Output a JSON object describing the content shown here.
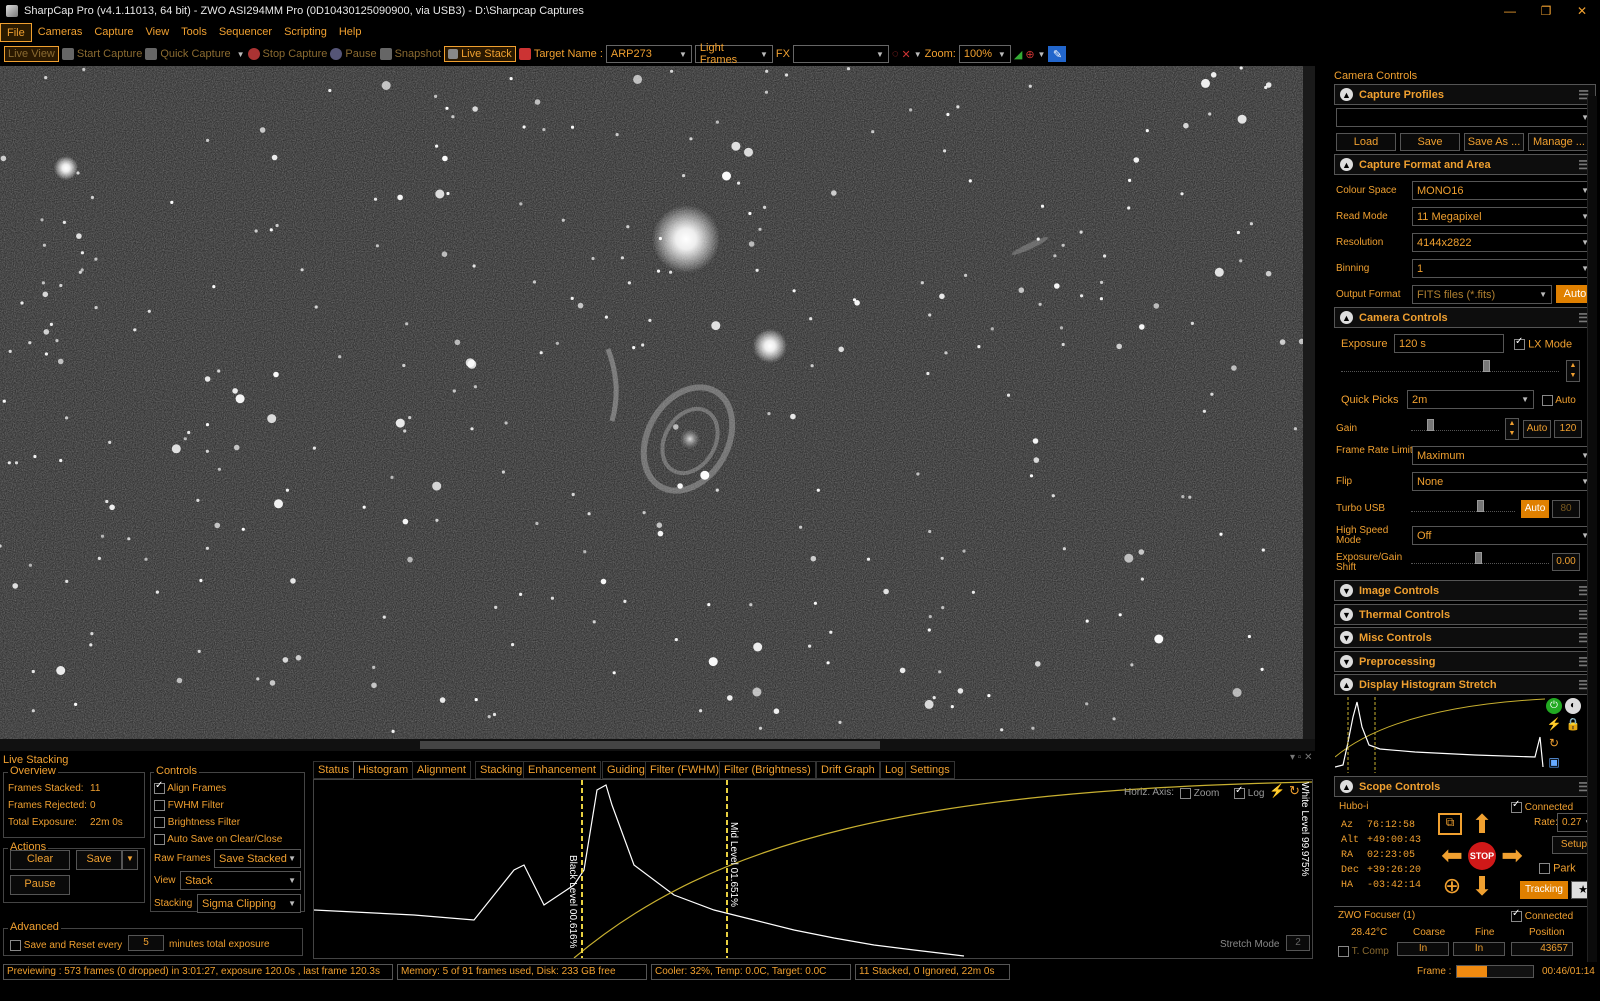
{
  "window": {
    "title": "SharpCap Pro (v4.1.11013, 64 bit) - ZWO ASI294MM Pro (0D10430125090900, via USB3) - D:\\Sharpcap Captures"
  },
  "menu": [
    "File",
    "Cameras",
    "Capture",
    "View",
    "Tools",
    "Sequencer",
    "Scripting",
    "Help"
  ],
  "toolbar": {
    "live_view": "Live View",
    "start_capture": "Start Capture",
    "quick_capture": "Quick Capture",
    "stop_capture": "Stop Capture",
    "pause": "Pause",
    "snapshot": "Snapshot",
    "live_stack": "Live Stack",
    "target_label": "Target Name :",
    "target_value": "ARP273",
    "frame_type": "Light Frames",
    "fx_label": "FX",
    "fx_value": "",
    "zoom_label": "Zoom:",
    "zoom_value": "100%"
  },
  "right_panel": {
    "title": "Camera Controls",
    "capture_profiles": {
      "header": "Capture Profiles",
      "profile_value": "",
      "buttons": [
        "Load",
        "Save",
        "Save As ...",
        "Manage ..."
      ]
    },
    "capture_format": {
      "header": "Capture Format and Area",
      "rows": [
        {
          "label": "Colour Space",
          "value": "MONO16"
        },
        {
          "label": "Read Mode",
          "value": "11 Megapixel"
        },
        {
          "label": "Resolution",
          "value": "4144x2822"
        },
        {
          "label": "Binning",
          "value": "1"
        },
        {
          "label": "Output Format",
          "value": "FITS files (*.fits)"
        }
      ],
      "auto": "Auto"
    },
    "camera_controls": {
      "header": "Camera Controls",
      "exposure_label": "Exposure",
      "exposure_value": "120 s",
      "lx_mode": "LX Mode",
      "quick_picks_label": "Quick Picks",
      "quick_picks_value": "2m",
      "auto": "Auto",
      "gain_label": "Gain",
      "gain_auto": "Auto",
      "gain_value": "120",
      "frame_rate_label": "Frame Rate Limit",
      "frame_rate_value": "Maximum",
      "flip_label": "Flip",
      "flip_value": "None",
      "turbo_label": "Turbo USB",
      "turbo_auto": "Auto",
      "turbo_value": "80",
      "high_speed_label": "High Speed Mode",
      "high_speed_value": "Off",
      "shift_label": "Exposure/Gain Shift",
      "shift_value": "0.00"
    },
    "collapsed": [
      "Image Controls",
      "Thermal Controls",
      "Misc Controls",
      "Preprocessing"
    ],
    "histogram_header": "Display Histogram Stretch",
    "scope": {
      "header": "Scope Controls",
      "name": "Hubo-i",
      "connected": "Connected",
      "coords": [
        {
          "k": "Az",
          "v": "76:12:58"
        },
        {
          "k": "Alt",
          "v": "+49:00:43"
        },
        {
          "k": "RA",
          "v": "02:23:05"
        },
        {
          "k": "Dec",
          "v": "+39:26:20"
        },
        {
          "k": "HA",
          "v": "-03:42:14"
        }
      ],
      "rate_label": "Rate:",
      "rate_value": "0.27",
      "setup": "Setup",
      "park": "Park",
      "stop": "STOP",
      "tracking": "Tracking"
    },
    "focuser": {
      "name": "ZWO Focuser (1)",
      "connected": "Connected",
      "temp": "28.42°C",
      "coarse": "Coarse",
      "fine": "Fine",
      "position_label": "Position",
      "t_comp": "T. Comp",
      "in": "In",
      "position_value": "43657"
    }
  },
  "live_stacking": {
    "title": "Live Stacking",
    "overview": {
      "title": "Overview",
      "frames_stacked_label": "Frames Stacked:",
      "frames_stacked": "11",
      "frames_rejected_label": "Frames Rejected:",
      "frames_rejected": "0",
      "total_exposure_label": "Total Exposure:",
      "total_exposure": "22m 0s"
    },
    "actions": {
      "title": "Actions",
      "clear": "Clear",
      "save": "Save",
      "pause": "Pause"
    },
    "advanced": {
      "title": "Advanced",
      "save_reset": "Save and Reset every",
      "minutes": "5",
      "minutes_suffix": "minutes total exposure"
    },
    "controls": {
      "title": "Controls",
      "checks": [
        {
          "label": "Align Frames",
          "on": true
        },
        {
          "label": "FWHM Filter",
          "on": false
        },
        {
          "label": "Brightness Filter",
          "on": false
        },
        {
          "label": "Auto Save on Clear/Close",
          "on": false
        }
      ],
      "raw_frames_label": "Raw Frames",
      "raw_frames_value": "Save Stacked",
      "view_label": "View",
      "view_value": "Stack",
      "stacking_label": "Stacking",
      "stacking_value": "Sigma Clipping"
    },
    "tabs": [
      "Status",
      "Histogram",
      "Alignment",
      "Stacking",
      "Enhancement",
      "Guiding",
      "Filter (FWHM)",
      "Filter (Brightness)",
      "Drift Graph",
      "Log",
      "Settings"
    ],
    "active_tab": "Histogram",
    "histogram": {
      "horiz_axis": "Horiz. Axis:",
      "zoom": "Zoom",
      "log": "Log",
      "black_level": "Black Level 00.616%",
      "mid_level": "Mid Level 01.651%",
      "white_level": "White Level 99.975%",
      "stretch_mode": "Stretch Mode",
      "stretch_value": "2"
    }
  },
  "status": {
    "preview": "Previewing : 573 frames (0 dropped) in 3:01:27, exposure 120.0s , last frame 120.3s",
    "memory": "Memory: 5 of 91 frames used, Disk: 233 GB free",
    "cooler": "Cooler: 32%, Temp: 0.0C, Target: 0.0C",
    "stacked": "11 Stacked, 0 Ignored, 22m 0s",
    "frame_label": "Frame :",
    "frame_progress": 0.4,
    "time": "00:46/01:14"
  }
}
